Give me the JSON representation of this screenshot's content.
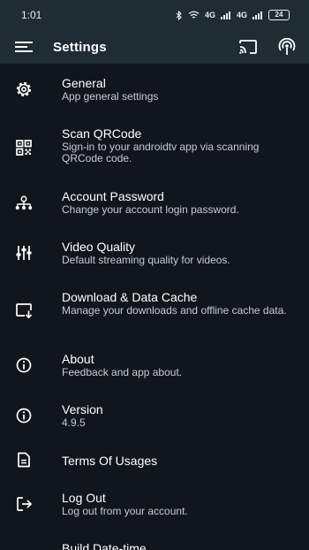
{
  "status_bar": {
    "time": "1:01",
    "network_labels": [
      "4G",
      "4G"
    ],
    "battery": "24"
  },
  "app_bar": {
    "title": "Settings",
    "icons": [
      "menu-icon",
      "cast-icon",
      "podcast-antenna-icon"
    ]
  },
  "settings": [
    {
      "title": "General",
      "subtitle": "App general settings",
      "icon": "gear-icon"
    },
    {
      "title": "Scan QRCode",
      "subtitle": "Sign-in to your androidtv app via scanning QRCode code.",
      "icon": "qrcode-icon"
    },
    {
      "title": "Account Password",
      "subtitle": "Change your account login password.",
      "icon": "account-tree-icon"
    },
    {
      "title": "Video Quality",
      "subtitle": "Default streaming quality for videos.",
      "icon": "sliders-icon"
    },
    {
      "title": "Download & Data Cache",
      "subtitle": "Manage your downloads and offline cache data.",
      "icon": "download-screen-icon"
    },
    {
      "title": "About",
      "subtitle": "Feedback and app about.",
      "icon": "info-icon"
    },
    {
      "title": "Version",
      "subtitle": "4.9.5",
      "icon": "info-icon"
    },
    {
      "title": "Terms Of Usages",
      "subtitle": "",
      "icon": "document-icon"
    },
    {
      "title": "Log Out",
      "subtitle": "Log out from your account.",
      "icon": "logout-icon"
    },
    {
      "title": "Build Date-time",
      "subtitle": "",
      "icon": ""
    }
  ]
}
